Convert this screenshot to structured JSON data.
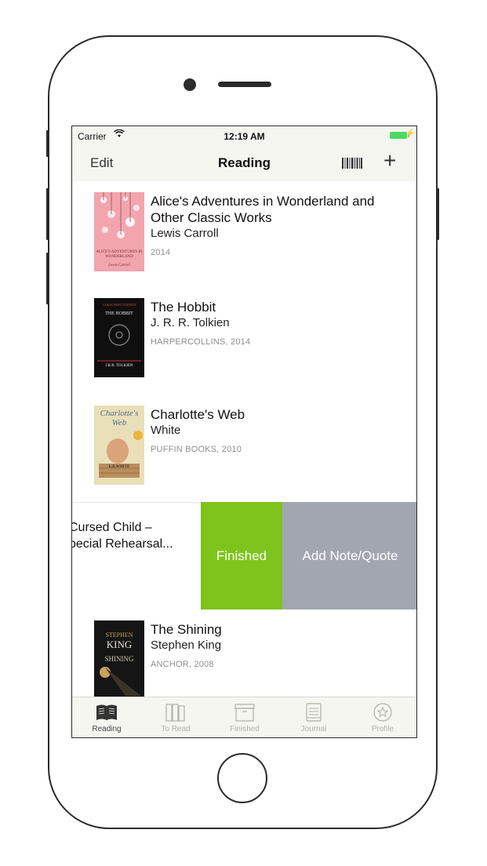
{
  "status_bar": {
    "carrier": "Carrier",
    "time": "12:19 AM"
  },
  "nav": {
    "edit_label": "Edit",
    "title": "Reading",
    "barcode_icon": "barcode-icon",
    "add_icon": "plus-icon"
  },
  "books": [
    {
      "title": "Alice's Adventures in Wonderland and Other Classic Works",
      "author": "Lewis Carroll",
      "meta": "2014",
      "cover_text": "ALICE'S ADVENTURES IN WONDERLAND",
      "cover_subtext": "Lewis Carroll"
    },
    {
      "title": "The Hobbit",
      "author": "J. R. R. Tolkien",
      "meta": "HARPERCOLLINS, 2014",
      "cover_text": "THE HOBBIT",
      "cover_top": "LARGE PRINT EDITION",
      "cover_subtext": "J.R.R. TOLKIEN"
    },
    {
      "title": "Charlotte's Web",
      "author": "White",
      "meta": "PUFFIN BOOKS, 2010",
      "cover_text": "Charlotte's Web",
      "cover_subtext": "E.B.WHITE"
    },
    {
      "title": "The Shining",
      "author": "Stephen King",
      "meta": "ANCHOR, 2008",
      "cover_top": "STEPHEN",
      "cover_text": "KING",
      "cover_subtext": "SHINING"
    }
  ],
  "swiped_row": {
    "title_line1": "Cursed Child –",
    "title_line2": "pecial Rehearsal...",
    "finished_label": "Finished",
    "note_label": "Add Note/Quote"
  },
  "tabs": [
    {
      "label": "Reading",
      "icon": "open-book-icon",
      "active": true
    },
    {
      "label": "To Read",
      "icon": "books-icon",
      "active": false
    },
    {
      "label": "Finished",
      "icon": "archive-box-icon",
      "active": false
    },
    {
      "label": "Journal",
      "icon": "notebook-icon",
      "active": false
    },
    {
      "label": "Profile",
      "icon": "star-circle-icon",
      "active": false
    }
  ],
  "colors": {
    "finished_action": "#7fc41c",
    "note_action": "#a2a6b0",
    "bar_bg": "#f6f6f1",
    "battery": "#4cd964"
  }
}
